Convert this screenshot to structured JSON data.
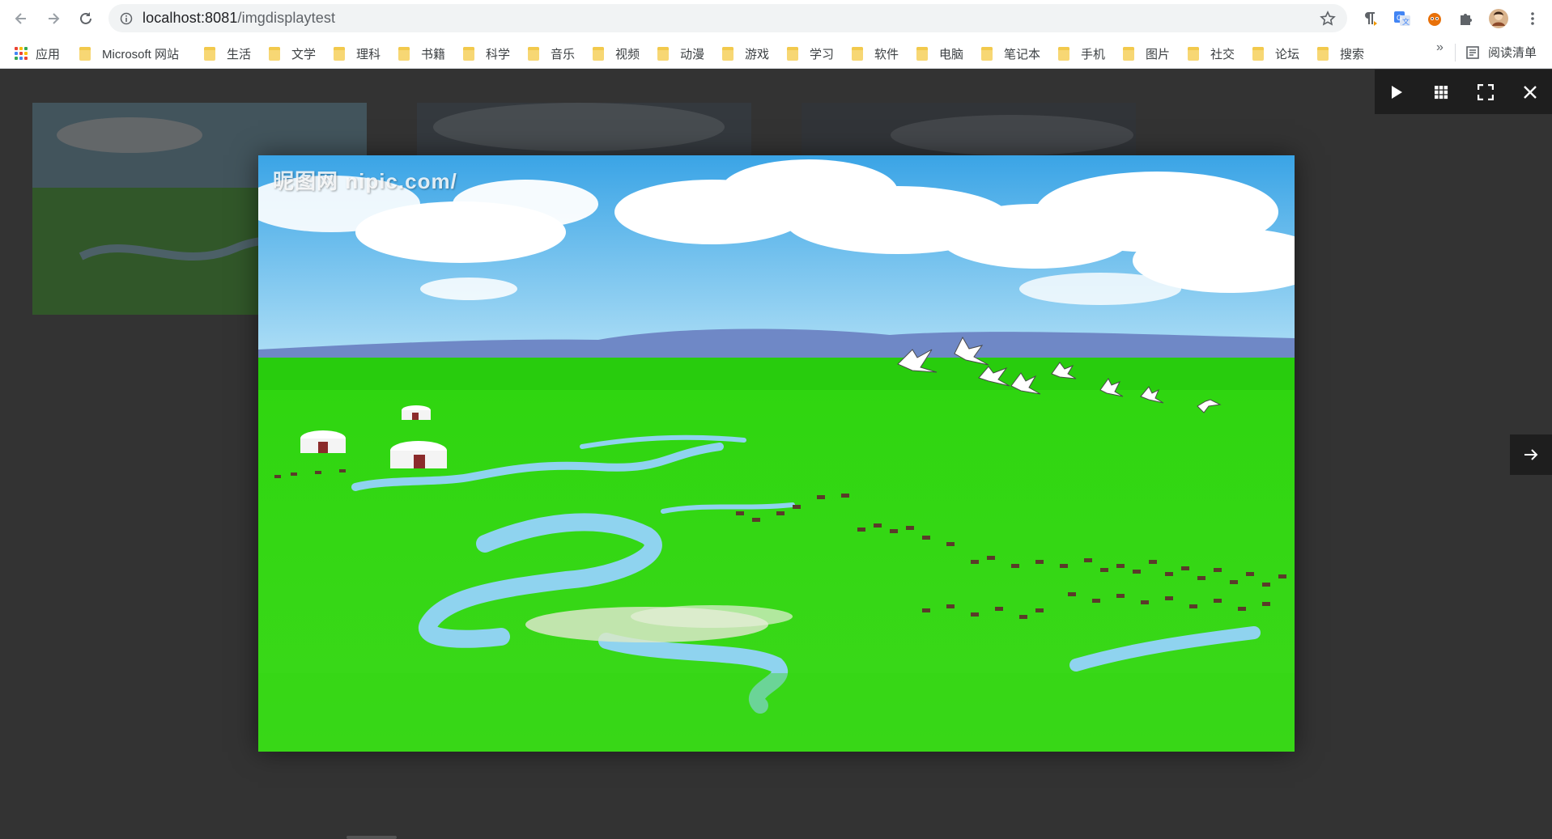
{
  "browser": {
    "url_host": "localhost:8081",
    "url_path": "/imgdisplaytest",
    "back_label": "Back",
    "forward_label": "Forward",
    "reload_label": "Reload"
  },
  "bookmarks": {
    "apps_label": "应用",
    "items": [
      {
        "label": "Microsoft 网站"
      },
      {
        "label": "生活"
      },
      {
        "label": "文学"
      },
      {
        "label": "理科"
      },
      {
        "label": "书籍"
      },
      {
        "label": "科学"
      },
      {
        "label": "音乐"
      },
      {
        "label": "视频"
      },
      {
        "label": "动漫"
      },
      {
        "label": "游戏"
      },
      {
        "label": "学习"
      },
      {
        "label": "软件"
      },
      {
        "label": "电脑"
      },
      {
        "label": "笔记本"
      },
      {
        "label": "手机"
      },
      {
        "label": "图片"
      },
      {
        "label": "社交"
      },
      {
        "label": "论坛"
      },
      {
        "label": "搜索"
      }
    ],
    "overflow": "»",
    "reading_list": "阅读清单"
  },
  "viewer": {
    "watermark": "昵图网 nipic.com/",
    "toolbar": [
      "play-icon",
      "grid-icon",
      "fullscreen-icon",
      "close-icon"
    ],
    "next": "arrow-right-icon"
  },
  "colors": {
    "page_bg": "#333333",
    "viewer_toolbar_bg": "#1e1e1e",
    "sky": "#59b4ea",
    "grass": "#2fd10f",
    "river": "#8fd3ef"
  }
}
